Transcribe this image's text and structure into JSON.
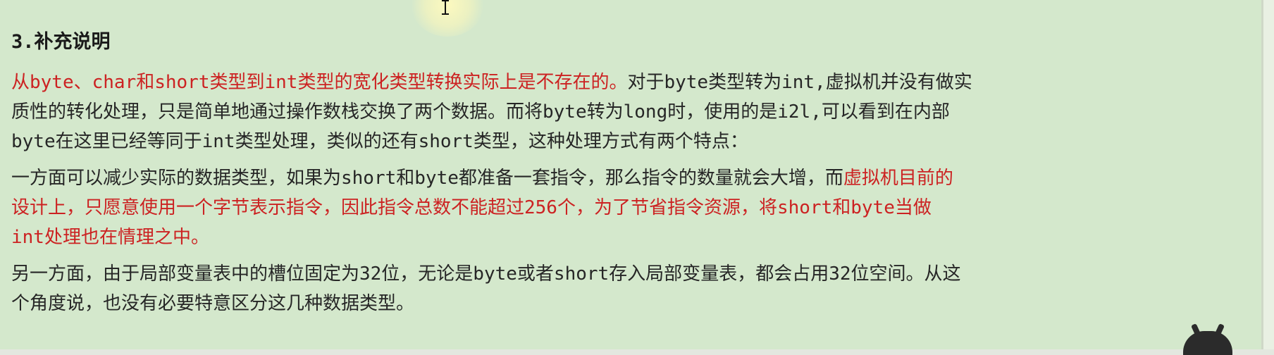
{
  "section": {
    "heading": "3.补充说明"
  },
  "paragraphs": {
    "p1": {
      "line1_red": "从byte、char和short类型到int类型的宽化类型转换实际上是不存在的。",
      "line1_rest": "对于byte类型转为int,虚拟机并没有做实",
      "line2": "质性的转化处理，只是简单地通过操作数栈交换了两个数据。而将byte转为long时，使用的是i2l,可以看到在内部",
      "line3": "byte在这里已经等同于int类型处理，类似的还有short类型，这种处理方式有两个特点："
    },
    "p2": {
      "line1_normal": "一方面可以减少实际的数据类型，如果为short和byte都准备一套指令，那么指令的数量就会大增，而",
      "line1_red": "虚拟机目前的",
      "line2_red": "设计上，只愿意使用一个字节表示指令，因此指令总数不能超过256个，为了节省指令资源，将short和byte当做",
      "line3_red": "int处理也在情理之中。"
    },
    "p3": {
      "line1": "另一方面，由于局部变量表中的槽位固定为32位，无论是byte或者short存入局部变量表，都会占用32位空间。从这",
      "line2": "个角度说，也没有必要特意区分这几种数据类型。"
    }
  },
  "colors": {
    "background": "#d4e8cc",
    "text": "#262626",
    "highlight_red": "#cc2222"
  },
  "icons": {
    "cursor": "text-cursor-icon",
    "corner": "mascot-icon"
  }
}
